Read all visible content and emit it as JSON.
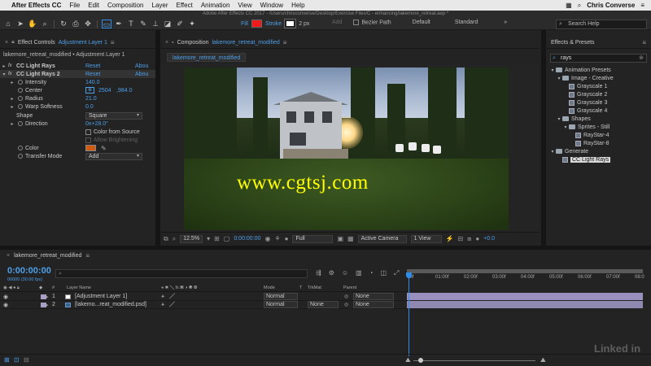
{
  "menubar": {
    "app_name": "After Effects CC",
    "items": [
      "File",
      "Edit",
      "Composition",
      "Layer",
      "Effect",
      "Animation",
      "View",
      "Window",
      "Help"
    ],
    "user": "Chris Converse"
  },
  "toolbar": {
    "doc_title": "Adobe After Effects CC 2017 - /Users/chrisconverse/Desktop/Exercise Files/C - enhancing/lakemore_retreat.aep *",
    "fill_label": "Fill",
    "stroke_label": "Stroke",
    "stroke_width": "2 px",
    "add_label": "Add",
    "bezier_label": "Bezier Path",
    "workspace_default": "Default",
    "workspace_standard": "Standard",
    "search_help_placeholder": "Search Help",
    "colors": {
      "fill": "#ef1a1a",
      "stroke": "#ffffff",
      "accent": "#4d9fe8"
    }
  },
  "effect_controls": {
    "tab_prefix": "Effect Controls",
    "tab_layer": "Adjustment Layer 1",
    "header": "lakemore_retreat_modified • Adjustment Layer 1",
    "rows": [
      {
        "name": "CC Light Rays",
        "reset": "Reset",
        "about": "Abou"
      },
      {
        "name": "CC Light Rays 2",
        "reset": "Reset",
        "about": "Abou"
      },
      {
        "name": "Intensity",
        "value": "140.0"
      },
      {
        "name": "Center",
        "value_x": "2504",
        "value_y": ",984.0"
      },
      {
        "name": "Radius",
        "value": "21.0"
      },
      {
        "name": "Warp Softness",
        "value": "0.0"
      },
      {
        "name": "Shape",
        "value": "Square"
      },
      {
        "name": "Direction",
        "value": "0x+28.0°"
      },
      {
        "name": "Color from Source"
      },
      {
        "name": "Allow Brightening"
      },
      {
        "name": "Color",
        "value": "#d05a10"
      },
      {
        "name": "Transfer Mode",
        "value": "Add"
      }
    ]
  },
  "composition": {
    "tab_prefix": "Composition",
    "tab_name": "lakemore_retreat_modified",
    "sub_tab": "lakemore_retreat_modified",
    "watermark": "www.cgtsj.com",
    "viewer_bar": {
      "zoom": "12.5%",
      "timecode": "0:00:00:00",
      "resolution": "Full",
      "camera": "Active Camera",
      "views": "1 View",
      "exposure": "+0.0"
    }
  },
  "effects_presets": {
    "title": "Effects & Presets",
    "search_value": "rays",
    "tree": [
      {
        "label": "Animation Presets",
        "indent": 0,
        "kind": "folder",
        "open": true
      },
      {
        "label": "Image - Creative",
        "indent": 1,
        "kind": "folder",
        "open": true
      },
      {
        "label": "Grayscale 1",
        "indent": 2,
        "kind": "preset"
      },
      {
        "label": "Grayscale 2",
        "indent": 2,
        "kind": "preset"
      },
      {
        "label": "Grayscale 3",
        "indent": 2,
        "kind": "preset"
      },
      {
        "label": "Grayscale 4",
        "indent": 2,
        "kind": "preset"
      },
      {
        "label": "Shapes",
        "indent": 1,
        "kind": "folder",
        "open": true
      },
      {
        "label": "Sprites - Still",
        "indent": 2,
        "kind": "folder",
        "open": true
      },
      {
        "label": "RayStar-4",
        "indent": 3,
        "kind": "preset"
      },
      {
        "label": "RayStar-8",
        "indent": 3,
        "kind": "preset"
      },
      {
        "label": "Generate",
        "indent": 0,
        "kind": "folder",
        "open": true
      },
      {
        "label": "CC Light Rays",
        "indent": 1,
        "kind": "preset",
        "selected": true
      }
    ]
  },
  "timeline": {
    "tab": "lakemore_retreat_modified",
    "timecode": "0:00:00:00",
    "frames": "00000 (30.00 fps)",
    "search_placeholder": "",
    "columns": {
      "layer_name": "Layer Name",
      "mode": "Mode",
      "t": "T",
      "trkmat": "TrkMat",
      "parent": "Parent"
    },
    "layers": [
      {
        "num": "1",
        "name": "[Adjustment Layer 1]",
        "mode": "Normal",
        "trkmat": "",
        "parent": "None",
        "color": "#a8a0c8"
      },
      {
        "num": "2",
        "name": "[lakemo...reat_modified.psd]",
        "mode": "Normal",
        "trkmat": "None",
        "parent": "None",
        "color": "#a8a0c8"
      }
    ],
    "ruler_ticks": [
      "00f",
      "01:00f",
      "02:00f",
      "03:00f",
      "04:00f",
      "05:00f",
      "06:00f",
      "07:00f",
      "08:0"
    ],
    "branding": "Linked in"
  }
}
